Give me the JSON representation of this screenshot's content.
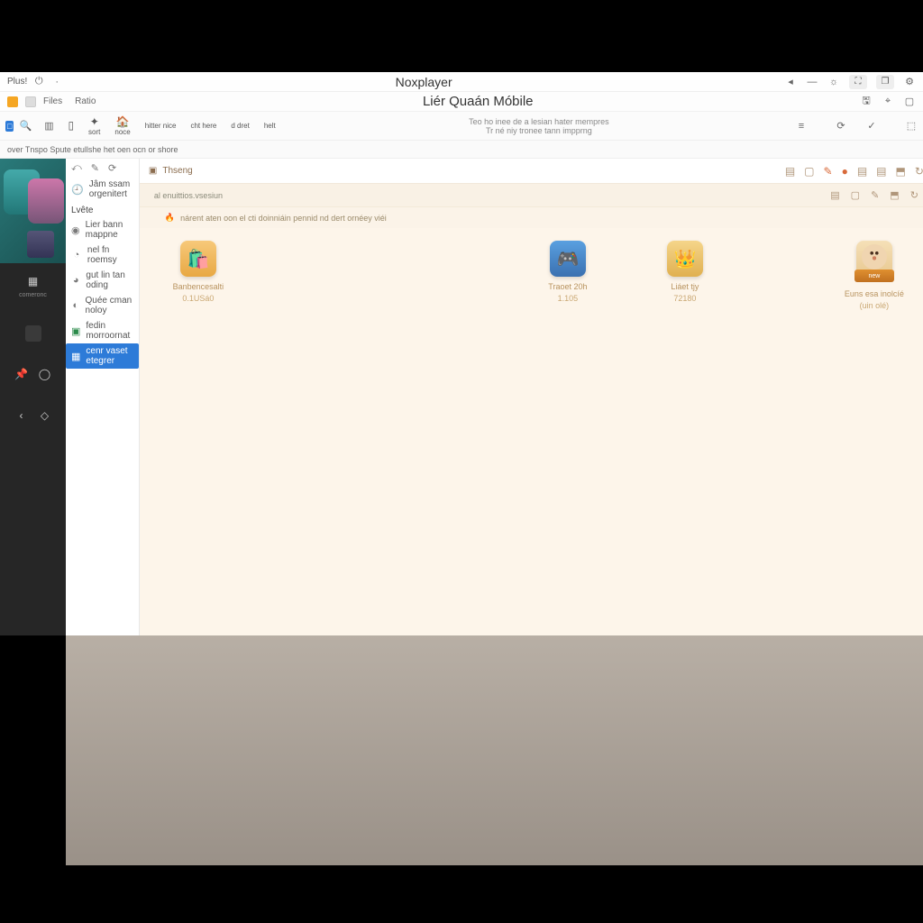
{
  "titlebar": {
    "left_label": "Plus!",
    "app_title": "Noxplayer"
  },
  "row2": {
    "left_label": "Files",
    "right_label": "Ratio",
    "game_title": "Liér Quaán Móbile"
  },
  "row3": {
    "items": [
      {
        "icon": "⬒",
        "label": ""
      },
      {
        "icon": "⭐",
        "label": "sort"
      },
      {
        "icon": "🏠",
        "label": "noce"
      },
      {
        "icon": "",
        "label": "hitter nice"
      },
      {
        "icon": "",
        "label": "cht here"
      },
      {
        "icon": "",
        "label": "d dret"
      },
      {
        "icon": "",
        "label": "helt"
      }
    ],
    "sub_left": "over Tnspo   Spute etullshe   het oen ocn or shore",
    "subtitle": "Teo ho inee de a lesian hater mempres",
    "subtitle2": "Tr né niy tronee tann impprng",
    "right_icons": [
      "≡",
      "⟳",
      "✓",
      "⬒"
    ]
  },
  "navbar": {
    "top_icons": [
      "⟨",
      "✎",
      "⟳"
    ],
    "recent_label": "Jâm ssam orgenitert",
    "section_title": "Lvête",
    "items": [
      {
        "icon": "◉",
        "label": "Lier bann mappne"
      },
      {
        "icon": "◔",
        "label": "nel fn roemsy"
      },
      {
        "icon": "◕",
        "label": "gut lin tan oding"
      },
      {
        "icon": "◐",
        "label": "Quée cman noloy"
      },
      {
        "icon": "▣",
        "label": "fedin morroornat"
      },
      {
        "icon": "▦",
        "label": "cenr vaset etegrer"
      }
    ]
  },
  "darkbar": {
    "label": "comeronc"
  },
  "content": {
    "header_icon": "▣",
    "header_label": "Thseng",
    "note1": "al enuittios.vsesiun",
    "note2": "nárent aten oon el cti doinniáin pennid nd dert ornéey viéi",
    "toolbar_icons": [
      "▤",
      "▢",
      "✎",
      "●",
      "▤",
      "▤",
      "⬒",
      "↻"
    ],
    "toolbar_icons2": [
      "▤",
      "▢",
      "✎",
      "⬒",
      "↻"
    ],
    "apps": [
      {
        "name": "Banbencesalti",
        "ver": "0.1USá0",
        "icon_class": "a-orange"
      },
      {
        "name": "Traoet 20h",
        "ver": "1.105",
        "icon_class": "a-blue"
      },
      {
        "name": "Liáet tjy",
        "ver": "72180",
        "icon_class": "a-gold"
      },
      {
        "name": "Euns esa inolcíé",
        "ver": "(uin olé)",
        "icon_class": "a-face",
        "badge": "new"
      }
    ]
  }
}
